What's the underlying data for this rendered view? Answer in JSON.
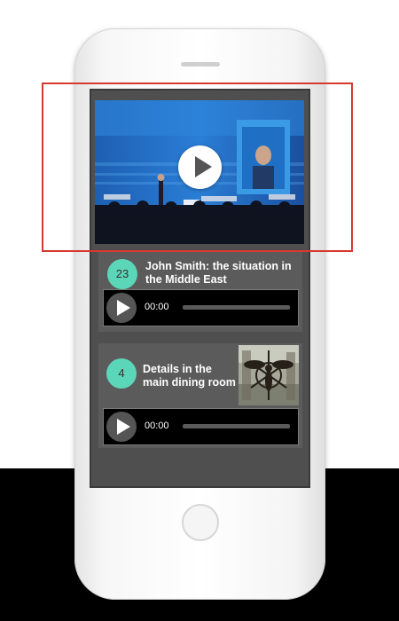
{
  "video": {
    "play_label": "Play video"
  },
  "tracks": [
    {
      "number": "23",
      "title": "John Smith: the situation in the Middle East",
      "time": "00:00"
    },
    {
      "number": "4",
      "title": "Details in the main dining room",
      "time": "00:00"
    }
  ],
  "colors": {
    "accent": "#5cd6b8",
    "highlight": "#d63a2f",
    "screen": "#4f4f4f",
    "card": "#5b5b5b",
    "player": "#000000"
  },
  "icons": [
    "play-icon",
    "play-icon",
    "play-icon"
  ]
}
